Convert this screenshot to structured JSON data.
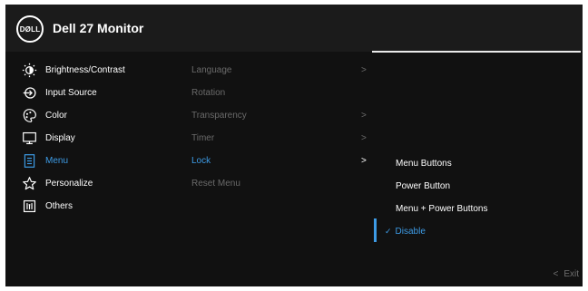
{
  "header": {
    "logo_text": "DØLL",
    "title": "Dell 27 Monitor"
  },
  "main_menu": [
    {
      "label": "Brightness/Contrast",
      "icon": "brightness-icon"
    },
    {
      "label": "Input Source",
      "icon": "input-source-icon"
    },
    {
      "label": "Color",
      "icon": "color-icon"
    },
    {
      "label": "Display",
      "icon": "display-icon"
    },
    {
      "label": "Menu",
      "icon": "menu-icon"
    },
    {
      "label": "Personalize",
      "icon": "star-icon"
    },
    {
      "label": "Others",
      "icon": "others-icon"
    }
  ],
  "submenu": [
    {
      "label": "Language",
      "chevron": ">"
    },
    {
      "label": "Rotation",
      "chevron": ""
    },
    {
      "label": "Transparency",
      "chevron": ">"
    },
    {
      "label": "Timer",
      "chevron": ">"
    },
    {
      "label": "Lock",
      "chevron": ">"
    },
    {
      "label": "Reset Menu",
      "chevron": ""
    }
  ],
  "lock_options": [
    {
      "label": "Menu Buttons"
    },
    {
      "label": "Power Button"
    },
    {
      "label": "Menu + Power Buttons"
    },
    {
      "label": "Disable",
      "check": "✓"
    }
  ],
  "footer": {
    "exit_arrow": "<",
    "exit_label": "Exit"
  },
  "colors": {
    "accent": "#3d9be5",
    "background": "#111111",
    "header": "#1b1b1b",
    "inactive": "#6a6a6a"
  }
}
